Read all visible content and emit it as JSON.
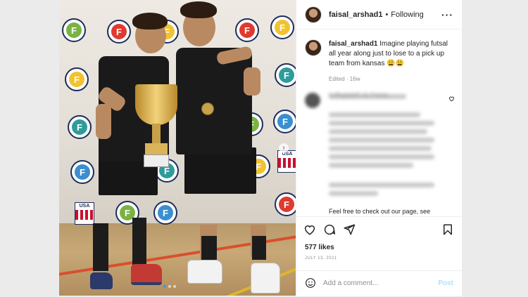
{
  "post": {
    "username": "faisal_arshad1",
    "separator": "•",
    "follow_status": "Following",
    "more": "···",
    "caption": "Imagine playing futsal all year along just to lose to a pick up team from kansas 😩😩",
    "edited": "Edited · 16w",
    "comment_preview_user": "lcdfbgljabl5 dc Faisal,",
    "comment_preview_more": "Feel free to check out our page, see",
    "likes": "577 likes",
    "date": "JULY 13, 2021",
    "comment_placeholder": "Add a comment...",
    "post_button": "Post",
    "carousel_next": "›"
  },
  "photo": {
    "logo_letters": [
      "F",
      "F",
      "F",
      "F",
      "F",
      "F",
      "F",
      "F",
      "F",
      "F",
      "F",
      "F",
      "F",
      "F",
      "F",
      "F"
    ],
    "usa_label": "USA",
    "colors": {
      "green": "#7bb342",
      "red": "#e03a2f",
      "yellow": "#f2c330",
      "teal": "#2f9c9a",
      "navy": "#1d2d5c",
      "blue": "#3a8fd0"
    }
  },
  "icons": [
    "heart-icon",
    "comment-icon",
    "share-icon",
    "bookmark-icon",
    "emoji-icon",
    "more-icon",
    "heart-small-icon"
  ]
}
